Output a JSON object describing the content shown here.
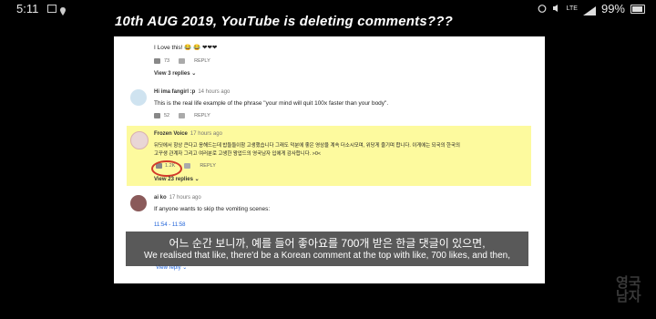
{
  "status_bar": {
    "time": "5:11",
    "battery": "99%",
    "network": "LTE"
  },
  "headline": "10th AUG 2019, YouTube is deleting comments???",
  "comments": [
    {
      "text": "I Love this! 😂 😂 ❤❤❤",
      "likes": "73",
      "reply": "REPLY",
      "view_replies": "View 3 replies ⌄"
    },
    {
      "author": "Hi ima fangirl :p",
      "time": "14 hours ago",
      "text": "This is the real life example of the phrase \"your mind will quit 100x faster than your body\".",
      "likes": "52",
      "reply": "REPLY"
    },
    {
      "author": "Frozen Voice",
      "time": "17 hours ago",
      "text_line1": "뒤딧에서 항상 큰다고 응해드는데 밥들들이참 고생했습니다 그래도 덕분에 좋은 영상을 계속 더소시모며, 위당게 즐기며 합니다. 이게에는 되국의 한국의",
      "text_line2": "고꾸생 관계자 그리고 여러분로 고생한 왕업드의 영국남자 입에게 감사합니다. >0<",
      "likes": "1.2K",
      "reply": "REPLY",
      "view_replies": "View 23 replies ⌄"
    },
    {
      "author": "ai ko",
      "time": "17 hours ago",
      "text": "If anyone wants to skip the vomiting scenes:",
      "timestamp": "11:54 - 11:58",
      "view_reply": "View reply ⌄"
    }
  ],
  "captions": {
    "korean": "어느 순간 보니까, 예를 들어 좋아요를 700개 받은 한글 댓글이 있으면,",
    "english": "We realised that like, there'd be a Korean comment at the top with like, 700 likes, and then,"
  },
  "watermark": "영국\n남자",
  "colors": {
    "highlight": "#fdfa9e",
    "circle": "#d23a2a",
    "link": "#1a5fd8"
  }
}
